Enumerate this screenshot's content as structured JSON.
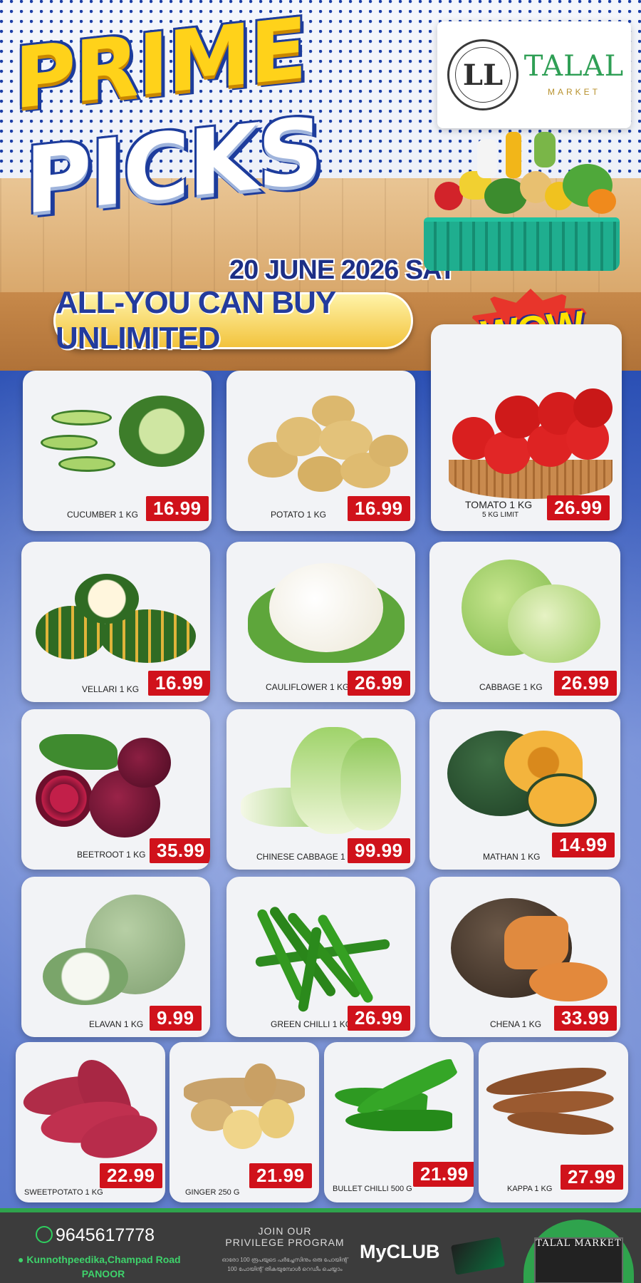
{
  "header": {
    "title_line1": "PRIME",
    "title_line2": "PICKS",
    "date": "20 JUNE 2026 SAT",
    "banner": "ALL-YOU CAN BUY  UNLIMITED",
    "wow": "WOW"
  },
  "brand": {
    "seal_text": "LL",
    "name": "TALAL",
    "sub": "MARKET",
    "accent": "#2f9f55"
  },
  "products": [
    {
      "name": "CUCUMBER 1 KG",
      "price": "16.99",
      "icon": "cucumber-icon"
    },
    {
      "name": "POTATO 1 KG",
      "price": "16.99",
      "icon": "potato-icon"
    },
    {
      "name": "TOMATO 1 KG",
      "note": "5 KG LIMIT",
      "price": "26.99",
      "icon": "tomato-icon"
    },
    {
      "name": "VELLARI 1 KG",
      "price": "16.99",
      "icon": "vellari-icon"
    },
    {
      "name": "CAULIFLOWER 1 KG",
      "price": "26.99",
      "icon": "cauliflower-icon"
    },
    {
      "name": "CABBAGE 1 KG",
      "price": "26.99",
      "icon": "cabbage-icon"
    },
    {
      "name": "BEETROOT 1 KG",
      "price": "35.99",
      "icon": "beetroot-icon"
    },
    {
      "name": "CHINESE CABBAGE 1 KG",
      "price": "99.99",
      "icon": "chinese-cabbage-icon"
    },
    {
      "name": "MATHAN 1 KG",
      "price": "14.99",
      "icon": "mathan-icon"
    },
    {
      "name": "ELAVAN 1 KG",
      "price": "9.99",
      "icon": "elavan-icon"
    },
    {
      "name": "GREEN CHILLI 1 KG",
      "price": "26.99",
      "icon": "green-chilli-icon"
    },
    {
      "name": "CHENA 1 KG",
      "price": "33.99",
      "icon": "chena-icon"
    },
    {
      "name": "SWEETPOTATO 1 KG",
      "price": "22.99",
      "icon": "sweetpotato-icon"
    },
    {
      "name": "GINGER 250 G",
      "price": "21.99",
      "icon": "ginger-icon"
    },
    {
      "name": "BULLET CHILLI 500 G",
      "price": "21.99",
      "icon": "bullet-chilli-icon"
    },
    {
      "name": "KAPPA 1 KG",
      "price": "27.99",
      "icon": "kappa-icon"
    }
  ],
  "footer": {
    "phone": "9645617778",
    "address": "Kunnothpeedika,Champad Road",
    "city": "PANOOR",
    "join_line1": "JOIN OUR",
    "join_line2": "PRIVILEGE PROGRAM",
    "malayalam_line1": "ഓരോ 100 രൂപയുടെ പർച്ചേസിനും ഒരു പോയിന്റ്",
    "malayalam_line2": "100 പോയിന്റ് തികയുമ്പോൾ റെഡീം ചെയ്യാം",
    "myclub": "MyCLUB",
    "store_label": "TALAL MARKET"
  },
  "colors": {
    "price_bg": "#d0121b",
    "title_yellow": "#ffd21a",
    "navy": "#1d3c9c"
  }
}
